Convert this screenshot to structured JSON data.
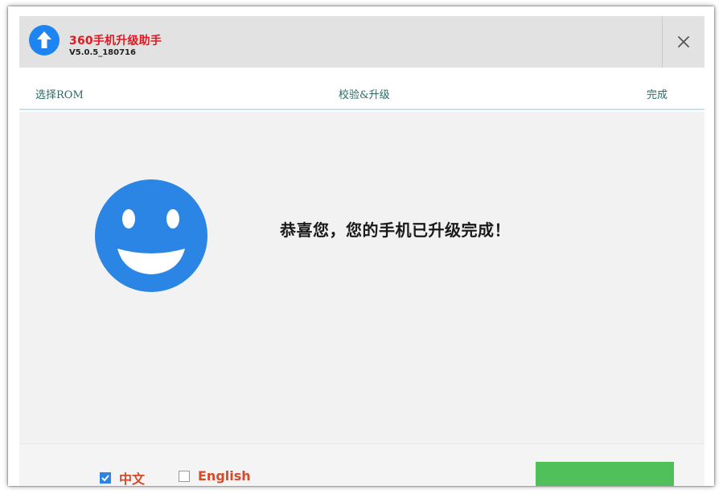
{
  "window": {
    "app_name": "360手机升级助手",
    "version": "V5.0.5_180716",
    "close_icon": "close-icon",
    "logo_icon": "upload-arrow-icon",
    "accent_color": "#1e84f1"
  },
  "steps": [
    {
      "label": "选择ROM"
    },
    {
      "label": "校验&升级"
    },
    {
      "label": "完成"
    }
  ],
  "content": {
    "icon": "smiley-face-icon",
    "message": "恭喜您，您的手机已升级完成！"
  },
  "footer": {
    "languages": [
      {
        "label": "中文",
        "checked": true
      },
      {
        "label": "English",
        "checked": false
      }
    ],
    "primary_button_color": "#4fc05a"
  }
}
